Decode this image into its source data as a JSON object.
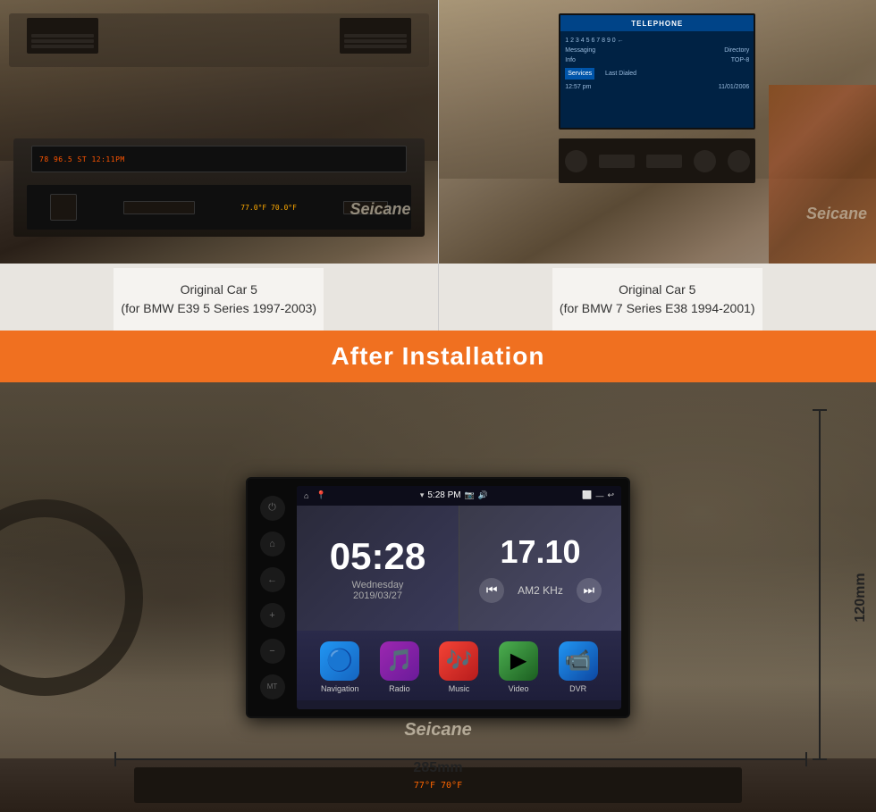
{
  "brand": "Seicane",
  "top_section": {
    "left_car": {
      "caption_line1": "Original Car 5",
      "caption_line2": "(for BMW E39 5 Series 1997-2003)"
    },
    "right_car": {
      "caption_line1": "Original Car 5",
      "caption_line2": "(for BMW 7 Series E38 1994-2001)",
      "screen_title": "TELEPHONE",
      "screen_content": "1 2 3 4 5 6 7 8 9 0 ←\nMessaging    Directory\nInfo         TOP-8\n             Last Dialed\n12:57 pm     11/01/2006"
    }
  },
  "after_installation": {
    "banner_text": "After Installation",
    "screen": {
      "status_bar": {
        "home_icon": "⌂",
        "pin_icon": "📍",
        "time": "5:28 PM",
        "camera_icon": "📷",
        "volume_icon": "🔊",
        "maximize_icon": "⬜",
        "minimize_icon": "—",
        "back_icon": "↩"
      },
      "clock": {
        "time": "05:28",
        "day": "Wednesday",
        "date": "2019/03/27"
      },
      "radio": {
        "frequency": "17.10",
        "band": "AM2  KHz",
        "prev_icon": "⏮",
        "next_icon": "⏭"
      },
      "apps": [
        {
          "label": "Navigation",
          "icon": "🔵"
        },
        {
          "label": "Radio",
          "icon": "🎵"
        },
        {
          "label": "Music",
          "icon": "🎶"
        },
        {
          "label": "Video",
          "icon": "▶"
        },
        {
          "label": "DVR",
          "icon": "📹"
        }
      ]
    },
    "dimensions": {
      "width": "285mm",
      "height": "120mm"
    },
    "bottom_temps": "77°F  70°F"
  }
}
